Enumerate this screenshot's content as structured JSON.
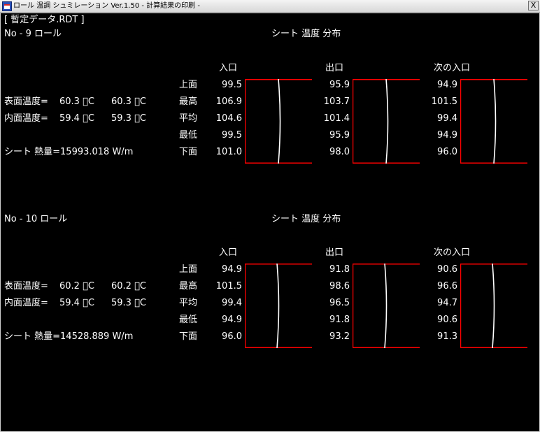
{
  "window": {
    "title": "ロール 温調 シュミレーション Ver.1.50 - 計算結果の印刷 -",
    "close_glyph": "X"
  },
  "file_label": "[ 暫定データ.RDT ]",
  "colors": {
    "background": "#000000",
    "text": "#ffffff",
    "box_edge": "#ff0000",
    "profile_curve": "#ffffff"
  },
  "sections": [
    {
      "roll_label": "No - 9 ロール",
      "dist_title": "シート 温度 分布",
      "surface_temp_label": "表面温度=",
      "surface_temp_1": "60.3 ゚C",
      "surface_temp_2": "60.3 ゚C",
      "inner_temp_label": "内面温度=",
      "inner_temp_1": "59.4 ゚C",
      "inner_temp_2": "59.3 ゚C",
      "heat_label": "シート 熱量=15993.018 W/m",
      "row_labels": [
        "上面",
        "最高",
        "平均",
        "最低",
        "下面"
      ],
      "columns": [
        {
          "header": "入口",
          "values": [
            "99.5",
            "106.9",
            "104.6",
            "99.5",
            "101.0"
          ]
        },
        {
          "header": "出口",
          "values": [
            "95.9",
            "103.7",
            "101.4",
            "95.9",
            "98.0"
          ]
        },
        {
          "header": "次の入口",
          "values": [
            "94.9",
            "101.5",
            "99.4",
            "94.9",
            "96.0"
          ]
        }
      ]
    },
    {
      "roll_label": "No - 10 ロール",
      "dist_title": "シート 温度 分布",
      "surface_temp_label": "表面温度=",
      "surface_temp_1": "60.2 ゚C",
      "surface_temp_2": "60.2 ゚C",
      "inner_temp_label": "内面温度=",
      "inner_temp_1": "59.4 ゚C",
      "inner_temp_2": "59.3 ゚C",
      "heat_label": "シート 熱量=14528.889 W/m",
      "row_labels": [
        "上面",
        "最高",
        "平均",
        "最低",
        "下面"
      ],
      "columns": [
        {
          "header": "入口",
          "values": [
            "94.9",
            "101.5",
            "99.4",
            "94.9",
            "96.0"
          ]
        },
        {
          "header": "出口",
          "values": [
            "91.8",
            "98.6",
            "96.5",
            "91.8",
            "93.2"
          ]
        },
        {
          "header": "次の入口",
          "values": [
            "90.6",
            "96.6",
            "94.7",
            "90.6",
            "91.3"
          ]
        }
      ]
    }
  ]
}
